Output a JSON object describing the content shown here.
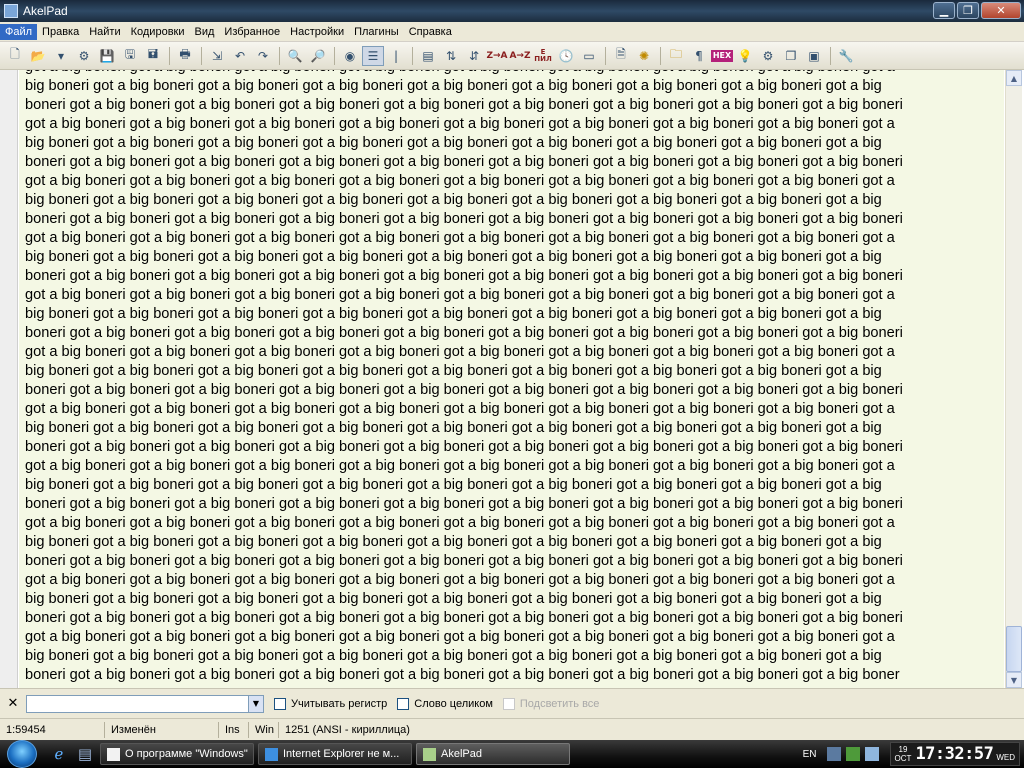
{
  "window": {
    "title": "AkelPad"
  },
  "window_buttons": {
    "minimize": "▁",
    "maximize": "❐",
    "close": "✕"
  },
  "menu": {
    "items": [
      "Файл",
      "Правка",
      "Найти",
      "Кодировки",
      "Вид",
      "Избранное",
      "Настройки",
      "Плагины",
      "Справка"
    ],
    "active": "Файл"
  },
  "toolbar": {
    "buttons": [
      "new-file-icon",
      "open-file-icon",
      "open-dropdown-icon",
      "reopen-icon",
      "save-icon",
      "save-all-icon",
      "save-as-icon",
      "print-icon",
      "select-all-icon",
      "undo-icon",
      "redo-icon",
      "find-icon",
      "replace-icon",
      "go-to-icon",
      "word-wrap-icon",
      "column-mode-icon",
      "insert-date-icon",
      "sort-asc-icon",
      "sort-desc-icon",
      "recode-icon",
      "transliterate-icon",
      "time-icon",
      "clipboard-icon",
      "plugin-icon",
      "settings-icon",
      "folder-icon",
      "pilcrow-icon",
      "hex-icon",
      "bulb-icon",
      "code-icon",
      "copy-icon",
      "frame-icon",
      "key-icon"
    ],
    "glyphs": {
      "z_arrow_a": "Z→A",
      "a_arrow_z": "A→Z",
      "hex": "HEX",
      "pilcrow": "¶",
      "e_pil": "Е",
      "pil": "ПИЛ"
    }
  },
  "editor": {
    "phrase": "big boneri got a ",
    "lines": [
      "got a big boneri got a big boneri got a big boneri got a big boneri got a big boneri got a big boneri got a big boneri got a big boneri got a",
      "big boneri got a big boneri got a big boneri got a big boneri got a big boneri got a big boneri got a big boneri got a big boneri got a big",
      "boneri got a big boneri got a big boneri got a big boneri got a big boneri got a big boneri got a big boneri got a big boneri got a big boneri",
      "got a big boneri got a big boneri got a big boneri got a big boneri got a big boneri got a big boneri got a big boneri got a big boneri got a",
      "big boneri got a big boneri got a big boneri got a big boneri got a big boneri got a big boneri got a big boneri got a big boneri got a big",
      "boneri got a big boneri got a big boneri got a big boneri got a big boneri got a big boneri got a big boneri got a big boneri got a big boneri",
      "got a big boneri got a big boneri got a big boneri got a big boneri got a big boneri got a big boneri got a big boneri got a big boneri got a",
      "big boneri got a big boneri got a big boneri got a big boneri got a big boneri got a big boneri got a big boneri got a big boneri got a big",
      "boneri got a big boneri got a big boneri got a big boneri got a big boneri got a big boneri got a big boneri got a big boneri got a big boneri",
      "got a big boneri got a big boneri got a big boneri got a big boneri got a big boneri got a big boneri got a big boneri got a big boneri got a",
      "big boneri got a big boneri got a big boneri got a big boneri got a big boneri got a big boneri got a big boneri got a big boneri got a big",
      "boneri got a big boneri got a big boneri got a big boneri got a big boneri got a big boneri got a big boneri got a big boneri got a big boneri",
      "got a big boneri got a big boneri got a big boneri got a big boneri got a big boneri got a big boneri got a big boneri got a big boneri got a",
      "big boneri got a big boneri got a big boneri got a big boneri got a big boneri got a big boneri got a big boneri got a big boneri got a big",
      "boneri got a big boneri got a big boneri got a big boneri got a big boneri got a big boneri got a big boneri got a big boneri got a big boneri",
      "got a big boneri got a big boneri got a big boneri got a big boneri got a big boneri got a big boneri got a big boneri got a big boneri got a",
      "big boneri got a big boneri got a big boneri got a big boneri got a big boneri got a big boneri got a big boneri got a big boneri got a big",
      "boneri got a big boneri got a big boneri got a big boneri got a big boneri got a big boneri got a big boneri got a big boneri got a big boneri",
      "got a big boneri got a big boneri got a big boneri got a big boneri got a big boneri got a big boneri got a big boneri got a big boneri got a",
      "big boneri got a big boneri got a big boneri got a big boneri got a big boneri got a big boneri got a big boneri got a big boneri got a big",
      "boneri got a big boneri got a big boneri got a big boneri got a big boneri got a big boneri got a big boneri got a big boneri got a big boneri",
      "got a big boneri got a big boneri got a big boneri got a big boneri got a big boneri got a big boneri got a big boneri got a big boneri got a",
      "big boneri got a big boneri got a big boneri got a big boneri got a big boneri got a big boneri got a big boneri got a big boneri got a big",
      "boneri got a big boneri got a big boneri got a big boneri got a big boneri got a big boneri got a big boneri got a big boneri got a big boneri",
      "got a big boneri got a big boneri got a big boneri got a big boneri got a big boneri got a big boneri got a big boneri got a big boneri got a",
      "big boneri got a big boneri got a big boneri got a big boneri got a big boneri got a big boneri got a big boneri got a big boneri got a big",
      "boneri got a big boneri got a big boneri got a big boneri got a big boneri got a big boneri got a big boneri got a big boneri got a big boneri",
      "got a big boneri got a big boneri got a big boneri got a big boneri got a big boneri got a big boneri got a big boneri got a big boneri got a",
      "big boneri got a big boneri got a big boneri got a big boneri got a big boneri got a big boneri got a big boneri got a big boneri got a big",
      "boneri got a big boneri got a big boneri got a big boneri got a big boneri got a big boneri got a big boneri got a big boneri got a big boneri",
      "got a big boneri got a big boneri got a big boneri got a big boneri got a big boneri got a big boneri got a big boneri got a big boneri got a",
      "big boneri got a big boneri got a big boneri got a big boneri got a big boneri got a big boneri got a big boneri got a big boneri got a big",
      "boneri got a big boneri got a big boneri got a big boneri got a big boneri got a big boneri got a big boneri got a big boneri got a big boner"
    ],
    "colors": {
      "background": "#f4f8e4",
      "gutter": "#eeeeee"
    }
  },
  "scrollbar": {
    "up": "▲",
    "down": "▼",
    "position_fraction": 0.96
  },
  "findbar": {
    "close": "✕",
    "query": "",
    "dropdown": "▼",
    "match_case": "Учитывать регистр",
    "whole_word": "Слово целиком",
    "highlight_all": "Подсветить все"
  },
  "status": {
    "position": "1:59454",
    "modified": "Изменён",
    "insert_mode": "Ins",
    "newline": "Win",
    "codepage": "1251  (ANSI - кириллица)"
  },
  "taskbar": {
    "tasks": [
      {
        "label": "О программе \"Windows\"",
        "active": false
      },
      {
        "label": "Internet Explorer не м...",
        "active": false
      },
      {
        "label": "AkelPad",
        "active": true
      }
    ],
    "language": "EN",
    "clock": {
      "day": "19",
      "month": "OCT",
      "time": "17:32:57",
      "weekday": "WED"
    }
  }
}
